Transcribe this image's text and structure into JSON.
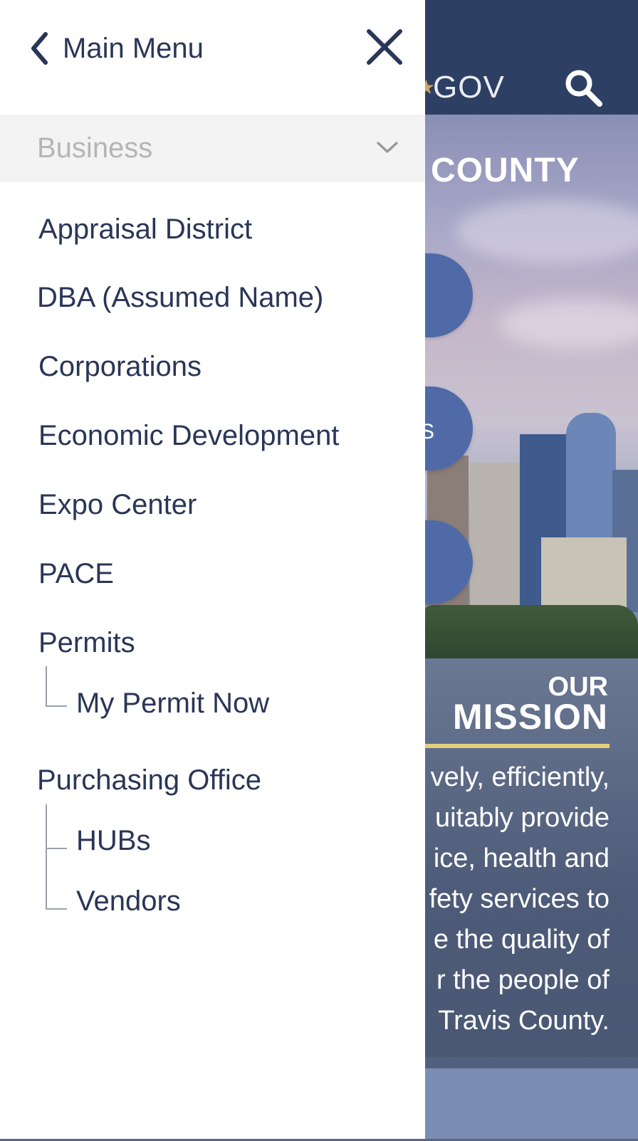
{
  "header": {
    "gov_text": "GOV",
    "search_icon": "search-icon"
  },
  "background": {
    "county_text": "COUNTY",
    "mission_heading_small": "OUR",
    "mission_heading_large": "MISSION",
    "mission_lines": [
      "vely, efficiently,",
      "uitably provide",
      "ice, health and",
      "fety services to",
      "e the quality of",
      "r the people of",
      "Travis County."
    ],
    "circle_partial_text": "S",
    "accent_color": "#e2cf7a",
    "brand_color": "#2d3f63"
  },
  "drawer": {
    "back_label": "Main Menu",
    "back_icon": "chevron-left-icon",
    "close_icon": "close-icon",
    "section_label": "Business",
    "section_icon": "chevron-down-icon",
    "items": [
      {
        "label": "Appraisal District"
      },
      {
        "label": "DBA (Assumed Name)"
      },
      {
        "label": "Corporations"
      },
      {
        "label": "Economic Development"
      },
      {
        "label": "Expo Center"
      },
      {
        "label": "PACE"
      },
      {
        "label": "Permits",
        "children": [
          {
            "label": "My Permit Now"
          }
        ]
      },
      {
        "label": "Purchasing Office",
        "children": [
          {
            "label": "HUBs"
          },
          {
            "label": "Vendors"
          }
        ]
      }
    ],
    "text_color": "#2a3657"
  }
}
